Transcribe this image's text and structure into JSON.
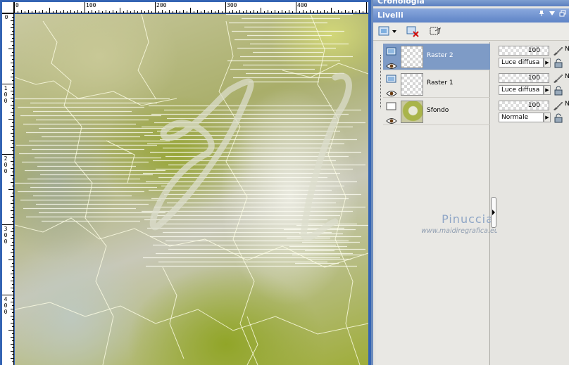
{
  "panels": {
    "cronologia_title": "Cronologia",
    "livelli_title": "Livelli"
  },
  "ruler": {
    "top_labels": [
      "0",
      "100",
      "200",
      "300",
      "400"
    ],
    "left_labels": [
      "0",
      "1 0 0",
      "2 0 0",
      "3 0 0",
      "4 0 0"
    ]
  },
  "layers": [
    {
      "name": "Raster 2",
      "opacity": "100",
      "blend": "Luce diffusa",
      "selected": true,
      "extra": "N"
    },
    {
      "name": "Raster 1",
      "opacity": "100",
      "blend": "Luce diffusa",
      "selected": false,
      "extra": "N"
    },
    {
      "name": "Sfondo",
      "opacity": "100",
      "blend": "Normale",
      "selected": false,
      "extra": "N"
    }
  ],
  "watermark": {
    "name": "Pinuccia",
    "url": "www.maidiregrafica.eu"
  },
  "colors": {
    "selection": "#7e9bc6",
    "titlebar": "#5e83c6"
  }
}
